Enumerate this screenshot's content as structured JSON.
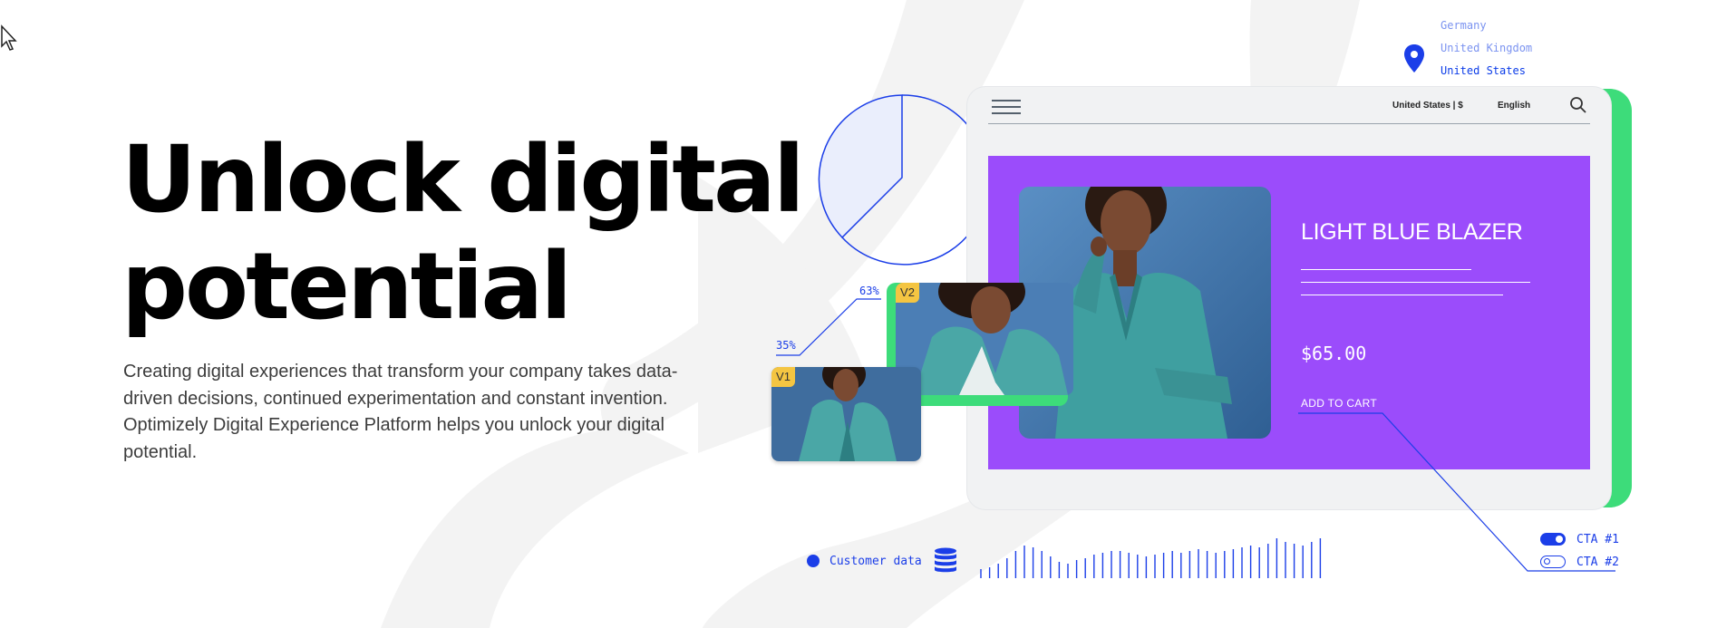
{
  "hero": {
    "title": "Unlock digital potential",
    "description": "Creating digital experiences that transform your company takes data-driven decisions, continued experimentation and constant invention. Optimizely Digital Experience Platform helps you unlock your digital potential."
  },
  "locations": [
    "Germany",
    "United Kingdom",
    "United States"
  ],
  "selected_location": "United States",
  "tablet": {
    "country_currency": "United States | $",
    "language": "English",
    "product": {
      "title": "LIGHT BLUE BLAZER",
      "price": "$65.00",
      "cta": "ADD TO CART"
    }
  },
  "variants": {
    "v1_label": "V1",
    "v2_label": "V2",
    "v1_pct": "35%",
    "v2_pct": "63%"
  },
  "customer_data_label": "Customer data",
  "cta_toggles": [
    {
      "label": "CTA #1",
      "on": true
    },
    {
      "label": "CTA #2",
      "on": false
    }
  ],
  "colors": {
    "accent_blue": "#1b3ee8",
    "purple": "#9b4cfb",
    "green": "#3ddc7a",
    "badge_yellow": "#f4c542"
  },
  "icons": [
    "cursor-icon",
    "location-pin-icon",
    "hamburger-menu-icon",
    "search-icon",
    "database-icon"
  ]
}
